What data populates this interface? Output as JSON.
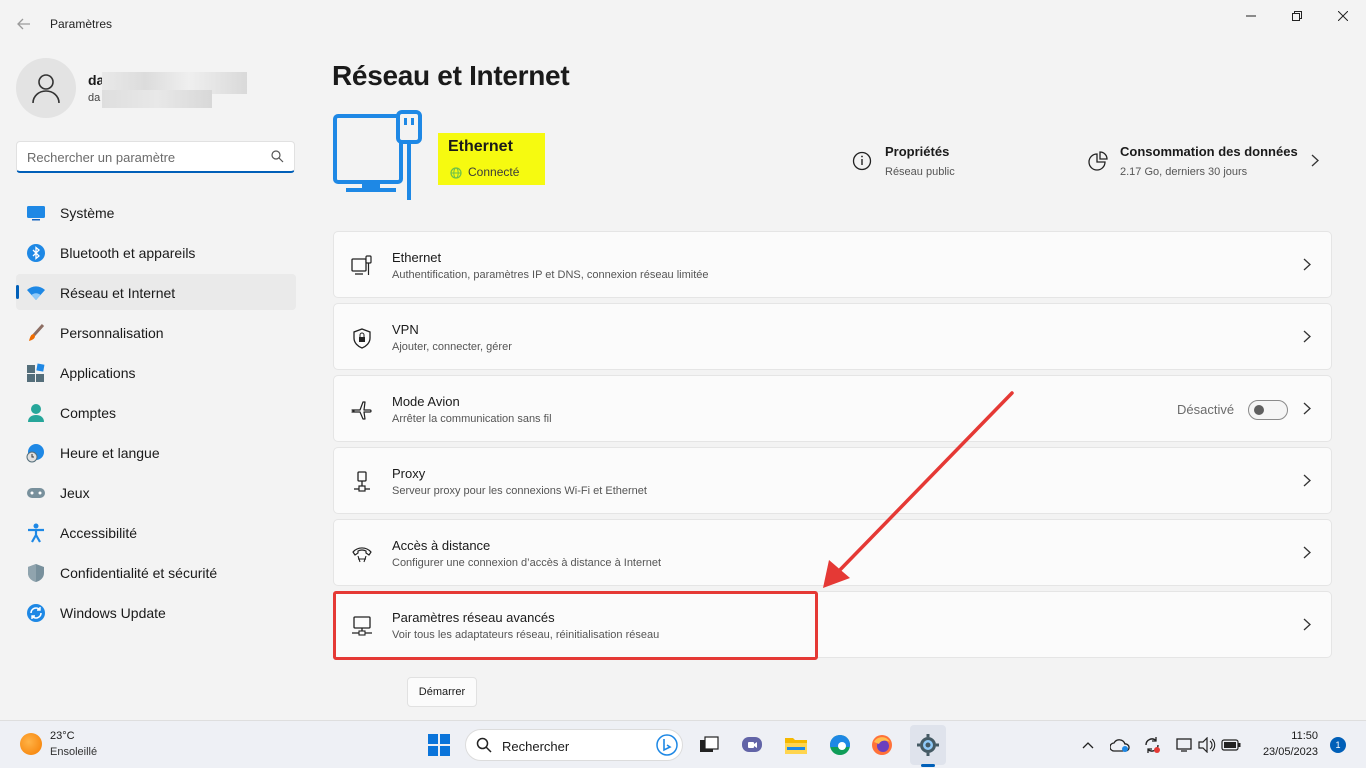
{
  "window": {
    "title": "Paramètres"
  },
  "user": {
    "name": "da",
    "email": "da"
  },
  "sidebar": {
    "search_placeholder": "Rechercher un paramètre",
    "items": [
      {
        "label": "Système",
        "icon": "system-icon"
      },
      {
        "label": "Bluetooth et appareils",
        "icon": "bluetooth-icon"
      },
      {
        "label": "Réseau et Internet",
        "icon": "wifi-icon",
        "active": true
      },
      {
        "label": "Personnalisation",
        "icon": "brush-icon"
      },
      {
        "label": "Applications",
        "icon": "apps-icon"
      },
      {
        "label": "Comptes",
        "icon": "accounts-icon"
      },
      {
        "label": "Heure et langue",
        "icon": "time-language-icon"
      },
      {
        "label": "Jeux",
        "icon": "gamepad-icon"
      },
      {
        "label": "Accessibilité",
        "icon": "accessibility-icon"
      },
      {
        "label": "Confidentialité et sécurité",
        "icon": "shield-icon"
      },
      {
        "label": "Windows Update",
        "icon": "update-icon"
      }
    ]
  },
  "main": {
    "title": "Réseau et Internet",
    "hero": {
      "name": "Ethernet",
      "status": "Connecté"
    },
    "properties": {
      "title": "Propriétés",
      "subtitle": "Réseau public"
    },
    "consumption": {
      "title": "Consommation des données",
      "subtitle": "2.17 Go, derniers 30 jours"
    },
    "cards": [
      {
        "title": "Ethernet",
        "subtitle": "Authentification, paramètres IP et DNS, connexion réseau limitée",
        "icon": "ethernet-icon"
      },
      {
        "title": "VPN",
        "subtitle": "Ajouter, connecter, gérer",
        "icon": "vpn-shield-icon"
      },
      {
        "title": "Mode Avion",
        "subtitle": "Arrêter la communication sans fil",
        "icon": "airplane-icon",
        "toggle_label": "Désactivé",
        "toggle_on": false
      },
      {
        "title": "Proxy",
        "subtitle": "Serveur proxy pour les connexions Wi-Fi et Ethernet",
        "icon": "proxy-icon"
      },
      {
        "title": "Accès à distance",
        "subtitle": "Configurer une connexion d’accès à distance à Internet",
        "icon": "dialup-icon"
      },
      {
        "title": "Paramètres réseau avancés",
        "subtitle": "Voir tous les adaptateurs réseau, réinitialisation réseau",
        "icon": "advanced-network-icon"
      }
    ],
    "start_button": "Démarrer"
  },
  "taskbar": {
    "weather": {
      "temp": "23°C",
      "condition": "Ensoleillé"
    },
    "search_label": "Rechercher",
    "clock": {
      "time": "11:50",
      "date": "23/05/2023"
    },
    "notifications": "1"
  },
  "colors": {
    "accent": "#005fb8",
    "highlight": "#f6fa10",
    "annotation": "#e53935",
    "ok": "#6cc04a"
  }
}
